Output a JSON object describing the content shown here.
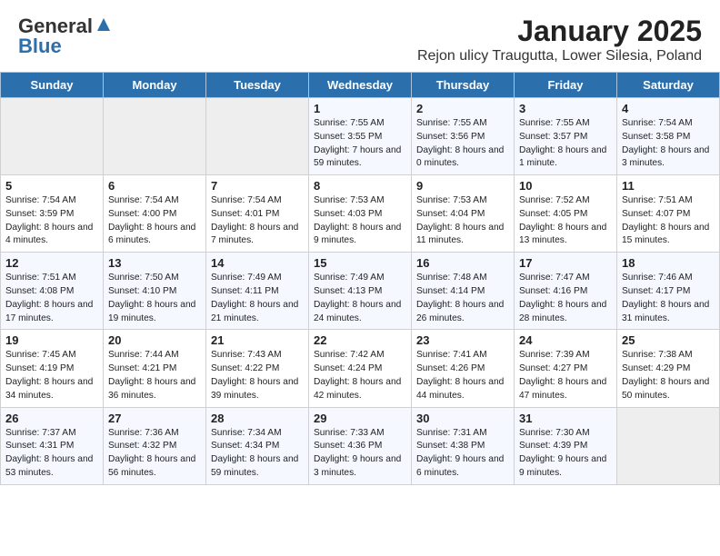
{
  "header": {
    "logo_general": "General",
    "logo_blue": "Blue",
    "title": "January 2025",
    "subtitle": "Rejon ulicy Traugutta, Lower Silesia, Poland"
  },
  "weekdays": [
    "Sunday",
    "Monday",
    "Tuesday",
    "Wednesday",
    "Thursday",
    "Friday",
    "Saturday"
  ],
  "weeks": [
    [
      {
        "day": "",
        "info": ""
      },
      {
        "day": "",
        "info": ""
      },
      {
        "day": "",
        "info": ""
      },
      {
        "day": "1",
        "info": "Sunrise: 7:55 AM\nSunset: 3:55 PM\nDaylight: 7 hours and 59 minutes."
      },
      {
        "day": "2",
        "info": "Sunrise: 7:55 AM\nSunset: 3:56 PM\nDaylight: 8 hours and 0 minutes."
      },
      {
        "day": "3",
        "info": "Sunrise: 7:55 AM\nSunset: 3:57 PM\nDaylight: 8 hours and 1 minute."
      },
      {
        "day": "4",
        "info": "Sunrise: 7:54 AM\nSunset: 3:58 PM\nDaylight: 8 hours and 3 minutes."
      }
    ],
    [
      {
        "day": "5",
        "info": "Sunrise: 7:54 AM\nSunset: 3:59 PM\nDaylight: 8 hours and 4 minutes."
      },
      {
        "day": "6",
        "info": "Sunrise: 7:54 AM\nSunset: 4:00 PM\nDaylight: 8 hours and 6 minutes."
      },
      {
        "day": "7",
        "info": "Sunrise: 7:54 AM\nSunset: 4:01 PM\nDaylight: 8 hours and 7 minutes."
      },
      {
        "day": "8",
        "info": "Sunrise: 7:53 AM\nSunset: 4:03 PM\nDaylight: 8 hours and 9 minutes."
      },
      {
        "day": "9",
        "info": "Sunrise: 7:53 AM\nSunset: 4:04 PM\nDaylight: 8 hours and 11 minutes."
      },
      {
        "day": "10",
        "info": "Sunrise: 7:52 AM\nSunset: 4:05 PM\nDaylight: 8 hours and 13 minutes."
      },
      {
        "day": "11",
        "info": "Sunrise: 7:51 AM\nSunset: 4:07 PM\nDaylight: 8 hours and 15 minutes."
      }
    ],
    [
      {
        "day": "12",
        "info": "Sunrise: 7:51 AM\nSunset: 4:08 PM\nDaylight: 8 hours and 17 minutes."
      },
      {
        "day": "13",
        "info": "Sunrise: 7:50 AM\nSunset: 4:10 PM\nDaylight: 8 hours and 19 minutes."
      },
      {
        "day": "14",
        "info": "Sunrise: 7:49 AM\nSunset: 4:11 PM\nDaylight: 8 hours and 21 minutes."
      },
      {
        "day": "15",
        "info": "Sunrise: 7:49 AM\nSunset: 4:13 PM\nDaylight: 8 hours and 24 minutes."
      },
      {
        "day": "16",
        "info": "Sunrise: 7:48 AM\nSunset: 4:14 PM\nDaylight: 8 hours and 26 minutes."
      },
      {
        "day": "17",
        "info": "Sunrise: 7:47 AM\nSunset: 4:16 PM\nDaylight: 8 hours and 28 minutes."
      },
      {
        "day": "18",
        "info": "Sunrise: 7:46 AM\nSunset: 4:17 PM\nDaylight: 8 hours and 31 minutes."
      }
    ],
    [
      {
        "day": "19",
        "info": "Sunrise: 7:45 AM\nSunset: 4:19 PM\nDaylight: 8 hours and 34 minutes."
      },
      {
        "day": "20",
        "info": "Sunrise: 7:44 AM\nSunset: 4:21 PM\nDaylight: 8 hours and 36 minutes."
      },
      {
        "day": "21",
        "info": "Sunrise: 7:43 AM\nSunset: 4:22 PM\nDaylight: 8 hours and 39 minutes."
      },
      {
        "day": "22",
        "info": "Sunrise: 7:42 AM\nSunset: 4:24 PM\nDaylight: 8 hours and 42 minutes."
      },
      {
        "day": "23",
        "info": "Sunrise: 7:41 AM\nSunset: 4:26 PM\nDaylight: 8 hours and 44 minutes."
      },
      {
        "day": "24",
        "info": "Sunrise: 7:39 AM\nSunset: 4:27 PM\nDaylight: 8 hours and 47 minutes."
      },
      {
        "day": "25",
        "info": "Sunrise: 7:38 AM\nSunset: 4:29 PM\nDaylight: 8 hours and 50 minutes."
      }
    ],
    [
      {
        "day": "26",
        "info": "Sunrise: 7:37 AM\nSunset: 4:31 PM\nDaylight: 8 hours and 53 minutes."
      },
      {
        "day": "27",
        "info": "Sunrise: 7:36 AM\nSunset: 4:32 PM\nDaylight: 8 hours and 56 minutes."
      },
      {
        "day": "28",
        "info": "Sunrise: 7:34 AM\nSunset: 4:34 PM\nDaylight: 8 hours and 59 minutes."
      },
      {
        "day": "29",
        "info": "Sunrise: 7:33 AM\nSunset: 4:36 PM\nDaylight: 9 hours and 3 minutes."
      },
      {
        "day": "30",
        "info": "Sunrise: 7:31 AM\nSunset: 4:38 PM\nDaylight: 9 hours and 6 minutes."
      },
      {
        "day": "31",
        "info": "Sunrise: 7:30 AM\nSunset: 4:39 PM\nDaylight: 9 hours and 9 minutes."
      },
      {
        "day": "",
        "info": ""
      }
    ]
  ]
}
